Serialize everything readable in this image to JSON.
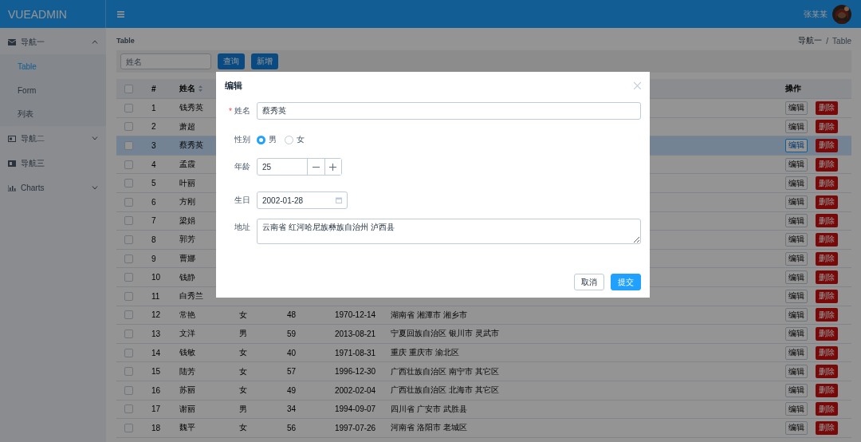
{
  "header": {
    "logo": "VUEADMIN",
    "user": "张某某"
  },
  "sidebar": {
    "items": [
      {
        "kind": "group",
        "label": "导航一",
        "expanded": true,
        "children": [
          {
            "label": "Table",
            "selected": true
          },
          {
            "label": "Form",
            "selected": false
          },
          {
            "label": "列表",
            "selected": false
          }
        ]
      },
      {
        "kind": "group",
        "label": "导航二",
        "expanded": false
      },
      {
        "kind": "link",
        "label": "导航三"
      },
      {
        "kind": "group",
        "label": "Charts",
        "expanded": false
      }
    ]
  },
  "page_title": "Table",
  "breadcrumb": {
    "items": [
      "导航一",
      "Table"
    ],
    "separator": "/"
  },
  "toolbar": {
    "search": {
      "placeholder": "姓名"
    },
    "buttons": [
      "查询",
      "新增"
    ]
  },
  "table": {
    "header": {
      "all_checked": false,
      "index": "#",
      "name": "姓名",
      "name_sortable": true,
      "actions": "操作"
    },
    "rows": [
      {
        "index": "1",
        "name": "钱秀英",
        "checked": false,
        "selected": false,
        "edit": "编辑",
        "delete": "删除",
        "edit_focused": false
      },
      {
        "index": "2",
        "name": "萧超",
        "checked": false,
        "selected": false,
        "edit": "编辑",
        "delete": "删除",
        "edit_focused": false
      },
      {
        "index": "3",
        "name": "蔡秀英",
        "checked": false,
        "selected": true,
        "edit": "编辑",
        "delete": "删除",
        "edit_focused": true
      },
      {
        "index": "4",
        "name": "孟霞",
        "checked": false,
        "selected": false,
        "edit": "编辑",
        "delete": "删除",
        "edit_focused": false
      },
      {
        "index": "5",
        "name": "叶丽",
        "checked": false,
        "selected": false,
        "edit": "编辑",
        "delete": "删除",
        "edit_focused": false
      },
      {
        "index": "6",
        "name": "方刚",
        "checked": false,
        "selected": false,
        "edit": "编辑",
        "delete": "删除",
        "edit_focused": false
      },
      {
        "index": "7",
        "name": "梁娟",
        "checked": false,
        "selected": false,
        "edit": "编辑",
        "delete": "删除",
        "edit_focused": false
      },
      {
        "index": "8",
        "name": "郭芳",
        "checked": false,
        "selected": false,
        "edit": "编辑",
        "delete": "删除",
        "edit_focused": false
      },
      {
        "index": "9",
        "name": "曹娜",
        "checked": false,
        "selected": false,
        "edit": "编辑",
        "delete": "删除",
        "edit_focused": false
      },
      {
        "index": "10",
        "name": "钱静",
        "checked": false,
        "selected": false,
        "edit": "编辑",
        "delete": "删除",
        "edit_focused": false
      },
      {
        "index": "11",
        "name": "白秀兰",
        "checked": false,
        "selected": false,
        "edit": "编辑",
        "delete": "删除",
        "edit_focused": false
      },
      {
        "index": "12",
        "name": "常艳",
        "gender": "女",
        "age": "48",
        "birthday": "1970-12-14",
        "address": "湖南省 湘潭市 湘乡市",
        "checked": false,
        "selected": false,
        "edit": "编辑",
        "delete": "删除",
        "edit_focused": false
      },
      {
        "index": "13",
        "name": "文洋",
        "gender": "男",
        "age": "59",
        "birthday": "2013-08-21",
        "address": "宁夏回族自治区 银川市 灵武市",
        "checked": false,
        "selected": false,
        "edit": "编辑",
        "delete": "删除",
        "edit_focused": false
      },
      {
        "index": "14",
        "name": "钱敏",
        "gender": "女",
        "age": "40",
        "birthday": "1971-08-31",
        "address": "重庆 重庆市 渝北区",
        "checked": false,
        "selected": false,
        "edit": "编辑",
        "delete": "删除",
        "edit_focused": false
      },
      {
        "index": "15",
        "name": "陆芳",
        "gender": "女",
        "age": "57",
        "birthday": "1996-12-30",
        "address": "广西壮族自治区 南宁市 其它区",
        "checked": false,
        "selected": false,
        "edit": "编辑",
        "delete": "删除",
        "edit_focused": false
      },
      {
        "index": "16",
        "name": "苏丽",
        "gender": "女",
        "age": "49",
        "birthday": "2002-02-04",
        "address": "广西壮族自治区 北海市 其它区",
        "checked": false,
        "selected": false,
        "edit": "编辑",
        "delete": "删除",
        "edit_focused": false
      },
      {
        "index": "17",
        "name": "谢丽",
        "gender": "男",
        "age": "34",
        "birthday": "1994-09-07",
        "address": "四川省 广安市 武胜县",
        "checked": false,
        "selected": false,
        "edit": "编辑",
        "delete": "删除",
        "edit_focused": false
      },
      {
        "index": "18",
        "name": "魏平",
        "gender": "女",
        "age": "56",
        "birthday": "1997-07-26",
        "address": "河南省 洛阳市 老城区",
        "checked": false,
        "selected": false,
        "edit": "编辑",
        "delete": "删除",
        "edit_focused": false
      }
    ]
  },
  "dialog": {
    "title": "编辑",
    "fields": [
      {
        "kind": "text",
        "label": "姓名",
        "required_mark": "*",
        "value": "蔡秀英"
      },
      {
        "kind": "radio",
        "label": "性别",
        "options": [
          {
            "label": "男",
            "selected": true
          },
          {
            "label": "女",
            "selected": false
          }
        ]
      },
      {
        "kind": "number",
        "label": "年龄",
        "value": "25"
      },
      {
        "kind": "date",
        "label": "生日",
        "value": "2002-01-28"
      },
      {
        "kind": "textarea",
        "label": "地址",
        "value": "云南省 红河哈尼族彝族自治州 泸西县"
      }
    ],
    "buttons": [
      {
        "label": "取消",
        "primary": false
      },
      {
        "label": "提交",
        "primary": true
      }
    ]
  }
}
